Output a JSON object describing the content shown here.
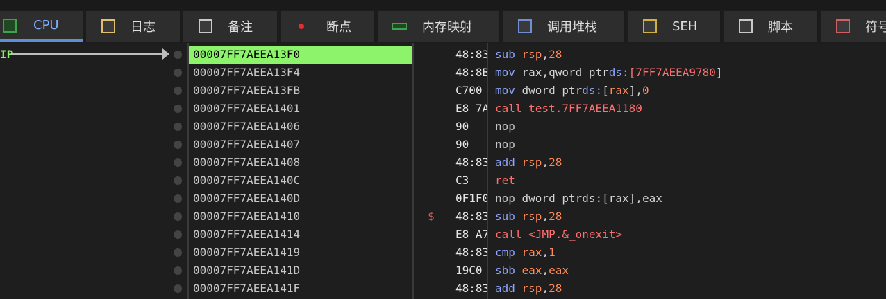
{
  "tabs": [
    {
      "label": "CPU",
      "icon": "cpu-icon",
      "active": true
    },
    {
      "label": "日志",
      "icon": "log-icon"
    },
    {
      "label": "备注",
      "icon": "notes-icon"
    },
    {
      "label": "断点",
      "icon": "breakpoint-icon"
    },
    {
      "label": "内存映射",
      "icon": "memory-map-icon"
    },
    {
      "label": "调用堆栈",
      "icon": "call-stack-icon"
    },
    {
      "label": "SEH",
      "icon": "seh-icon"
    },
    {
      "label": "脚本",
      "icon": "script-icon"
    },
    {
      "label": "符号",
      "icon": "symbols-icon"
    }
  ],
  "rip_label": "IP",
  "rows": [
    {
      "addr": "00007FF7AEEA13F0",
      "bytes": "48:83",
      "mn": "sub",
      "ops": [
        [
          "rsp",
          "r"
        ],
        [
          ",",
          "t"
        ],
        [
          "28",
          "n"
        ]
      ],
      "cls": "blue"
    },
    {
      "addr": "00007FF7AEEA13F4",
      "bytes": "48:8B",
      "mn": "mov",
      "ops": [
        [
          "rax",
          "t"
        ],
        [
          ",qword ptr",
          "t"
        ],
        [
          "ds:",
          "s"
        ],
        [
          "[7FF7AEEA9780",
          "y"
        ],
        [
          "]",
          "t"
        ]
      ],
      "cls": "blue"
    },
    {
      "addr": "00007FF7AEEA13FB",
      "bytes": "C700",
      "mn": "mov",
      "ops": [
        [
          "dword ptr",
          "t"
        ],
        [
          "ds:",
          "s"
        ],
        [
          "[",
          "t"
        ],
        [
          "rax",
          "r"
        ],
        [
          "],",
          "t"
        ],
        [
          "0",
          "n"
        ]
      ],
      "cls": "blue"
    },
    {
      "addr": "00007FF7AEEA1401",
      "bytes": "E8 7A",
      "mn": "call",
      "ops": [
        [
          "test.7FF7AEEA1180",
          "y"
        ]
      ],
      "cls": "red"
    },
    {
      "addr": "00007FF7AEEA1406",
      "bytes": "90",
      "mn": "nop",
      "ops": [],
      "cls": "gray"
    },
    {
      "addr": "00007FF7AEEA1407",
      "bytes": "90",
      "mn": "nop",
      "ops": [],
      "cls": "gray"
    },
    {
      "addr": "00007FF7AEEA1408",
      "bytes": "48:83",
      "mn": "add",
      "ops": [
        [
          "rsp",
          "r"
        ],
        [
          ",",
          "t"
        ],
        [
          "28",
          "n"
        ]
      ],
      "cls": "blue"
    },
    {
      "addr": "00007FF7AEEA140C",
      "bytes": "C3",
      "mn": "ret",
      "ops": [],
      "cls": "red"
    },
    {
      "addr": "00007FF7AEEA140D",
      "bytes": "0F1F0",
      "mn": "nop",
      "ops": [
        [
          "dword ptr",
          "t"
        ],
        [
          "ds:",
          "t"
        ],
        [
          "[rax],eax",
          "t"
        ]
      ],
      "cls": "gray"
    },
    {
      "addr": "00007FF7AEEA1410",
      "bytes": "48:83",
      "mn": "sub",
      "ops": [
        [
          "rsp",
          "r"
        ],
        [
          ",",
          "t"
        ],
        [
          "28",
          "n"
        ]
      ],
      "cls": "blue",
      "marker": "$"
    },
    {
      "addr": "00007FF7AEEA1414",
      "bytes": "E8 A7",
      "mn": "call",
      "ops": [
        [
          "<JMP.&_onexit>",
          "y"
        ]
      ],
      "cls": "red"
    },
    {
      "addr": "00007FF7AEEA1419",
      "bytes": "48:83",
      "mn": "cmp",
      "ops": [
        [
          "rax",
          "r"
        ],
        [
          ",",
          "t"
        ],
        [
          "1",
          "n"
        ]
      ],
      "cls": "blue"
    },
    {
      "addr": "00007FF7AEEA141D",
      "bytes": "19C0",
      "mn": "sbb",
      "ops": [
        [
          "eax",
          "r"
        ],
        [
          ",",
          "t"
        ],
        [
          "eax",
          "r"
        ]
      ],
      "cls": "blue"
    },
    {
      "addr": "00007FF7AEEA141F",
      "bytes": "48:83",
      "mn": "add",
      "ops": [
        [
          "rsp",
          "r"
        ],
        [
          ",",
          "t"
        ],
        [
          "28",
          "n"
        ]
      ],
      "cls": "blue"
    }
  ]
}
